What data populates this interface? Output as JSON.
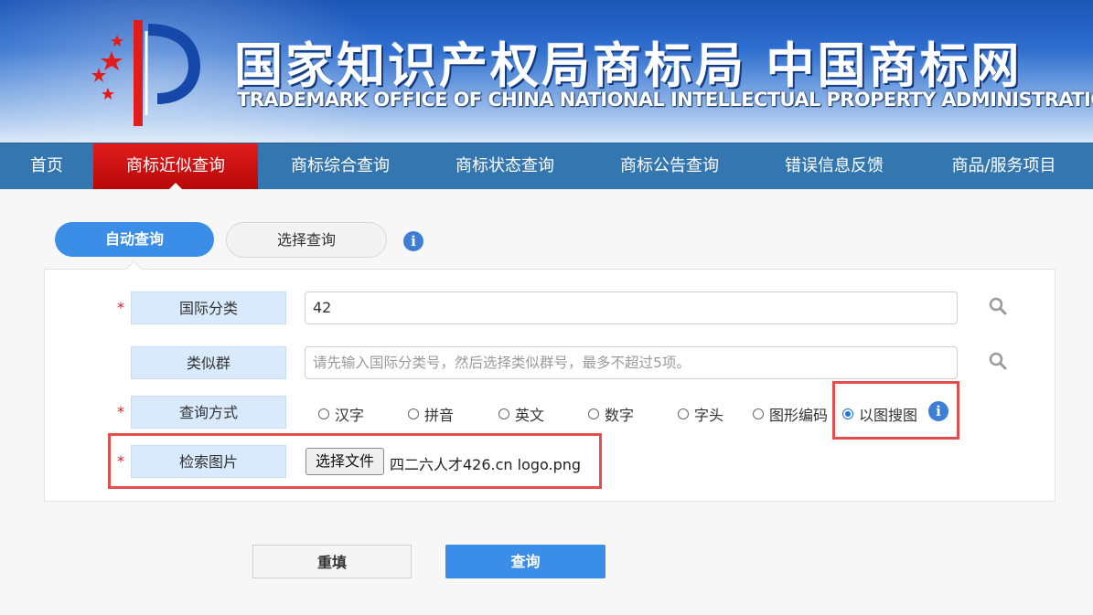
{
  "header": {
    "title_cn": "国家知识产权局商标局 中国商标网",
    "title_en": "TRADEMARK OFFICE OF CHINA NATIONAL INTELLECTUAL PROPERTY ADMINISTRATION"
  },
  "nav": {
    "items": [
      {
        "label": "首页"
      },
      {
        "label": "商标近似查询"
      },
      {
        "label": "商标综合查询"
      },
      {
        "label": "商标状态查询"
      },
      {
        "label": "商标公告查询"
      },
      {
        "label": "错误信息反馈"
      },
      {
        "label": "商品/服务项目"
      }
    ],
    "active_index": 1
  },
  "tabs": {
    "auto": "自动查询",
    "select": "选择查询",
    "info_icon": "i"
  },
  "form": {
    "required_mark": "*",
    "intl_class": {
      "label": "国际分类",
      "value": "42"
    },
    "similar_group": {
      "label": "类似群",
      "placeholder": "请先输入国际分类号，然后选择类似群号，最多不超过5项。"
    },
    "query_mode": {
      "label": "查询方式",
      "options": [
        "汉字",
        "拼音",
        "英文",
        "数字",
        "字头",
        "图形编码",
        "以图搜图"
      ],
      "selected": "以图搜图"
    },
    "image": {
      "label": "检索图片",
      "button": "选择文件",
      "filename": "四二六人才426.cn logo.png"
    }
  },
  "actions": {
    "reset": "重填",
    "search": "查询"
  },
  "colors": {
    "nav_bg": "#3376b0",
    "nav_active": "#d41414",
    "primary": "#3a8ee8",
    "highlight_box": "#e44d4d"
  }
}
